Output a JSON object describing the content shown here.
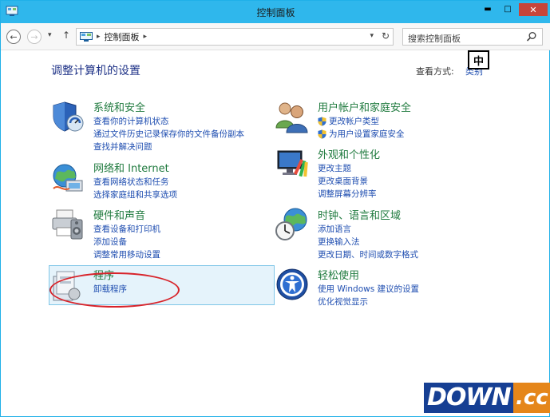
{
  "window": {
    "title": "控制面板",
    "minimize_glyph": "▬",
    "maximize_glyph": "□",
    "close_glyph": "✕"
  },
  "nav": {
    "back_glyph": "←",
    "forward_glyph": "→",
    "recent_glyph": "▾",
    "up_glyph": "↑",
    "breadcrumb_sep": "▸",
    "address_text": "控制面板",
    "address_sep_end": "▸",
    "dropdown_glyph": "▾",
    "refresh_glyph": "↻",
    "search_placeholder": "搜索控制面板"
  },
  "content": {
    "heading": "调整计算机的设置",
    "view_by_label": "查看方式:",
    "view_by_value": "类别",
    "ime_indicator": "中"
  },
  "categories": [
    {
      "title": "系统和安全",
      "icon": "shield-icon",
      "links": [
        "查看你的计算机状态",
        "通过文件历史记录保存你的文件备份副本",
        "查找并解决问题"
      ]
    },
    {
      "title": "网络和 Internet",
      "icon": "network-globe-icon",
      "links": [
        "查看网络状态和任务",
        "选择家庭组和共享选项"
      ]
    },
    {
      "title": "硬件和声音",
      "icon": "printer-icon",
      "links": [
        "查看设备和打印机",
        "添加设备",
        "调整常用移动设置"
      ]
    },
    {
      "title": "程序",
      "icon": "programs-icon",
      "links": [
        "卸载程序"
      ]
    },
    {
      "title": "用户帐户和家庭安全",
      "icon": "users-icon",
      "links": [
        "更改帐户类型",
        "为用户设置家庭安全"
      ]
    },
    {
      "title": "外观和个性化",
      "icon": "display-paint-icon",
      "links": [
        "更改主题",
        "更改桌面背景",
        "调整屏幕分辨率"
      ]
    },
    {
      "title": "时钟、语言和区域",
      "icon": "clock-globe-icon",
      "links": [
        "添加语言",
        "更换输入法",
        "更改日期、时间或数字格式"
      ]
    },
    {
      "title": "轻松使用",
      "icon": "ease-of-access-icon",
      "links": [
        "使用 Windows 建议的设置",
        "优化视觉显示"
      ]
    }
  ],
  "watermark": {
    "brand": "DOWN",
    "suffix": ".cc"
  },
  "colors": {
    "titlebar": "#2fb7ec",
    "heading": "#1e3287",
    "category_title": "#1f7a3e",
    "link": "#1e4db0",
    "annotation": "#d8232a"
  }
}
